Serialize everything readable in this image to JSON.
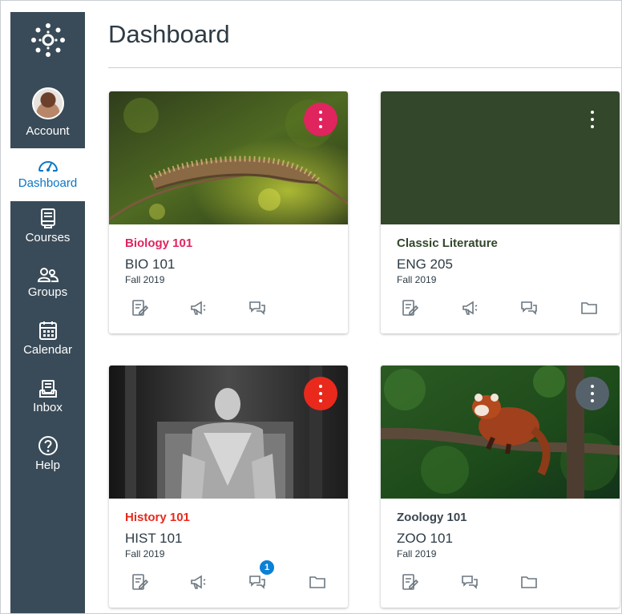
{
  "nav": {
    "account": "Account",
    "dashboard": "Dashboard",
    "courses": "Courses",
    "groups": "Groups",
    "calendar": "Calendar",
    "inbox": "Inbox",
    "help": "Help",
    "colors": {
      "background": "#394b58",
      "active_text": "#0b76c5"
    }
  },
  "page": {
    "title": "Dashboard"
  },
  "cards": [
    {
      "title": "Biology 101",
      "code": "BIO 101",
      "term": "Fall 2019",
      "color": "#e0245e",
      "image": "caterpillar-photo",
      "actions": [
        "assignments-icon",
        "announcements-icon",
        "discussions-icon"
      ]
    },
    {
      "title": "Classic Literature",
      "code": "ENG 205",
      "term": "Fall 2019",
      "color": "#33472b",
      "image": "none",
      "actions": [
        "assignments-icon",
        "announcements-icon",
        "discussions-icon",
        "files-icon"
      ]
    },
    {
      "title": "History 101",
      "code": "HIST 101",
      "term": "Fall 2019",
      "color": "#e8291c",
      "image": "lincoln-memorial-photo",
      "actions": [
        "assignments-icon",
        "announcements-icon",
        "discussions-icon",
        "files-icon"
      ],
      "discussion_badge": "1"
    },
    {
      "title": "Zoology 101",
      "code": "ZOO 101",
      "term": "Fall 2019",
      "color": "#56626b",
      "image": "red-panda-photo",
      "actions": [
        "assignments-icon",
        "discussions-icon",
        "files-icon"
      ]
    }
  ]
}
